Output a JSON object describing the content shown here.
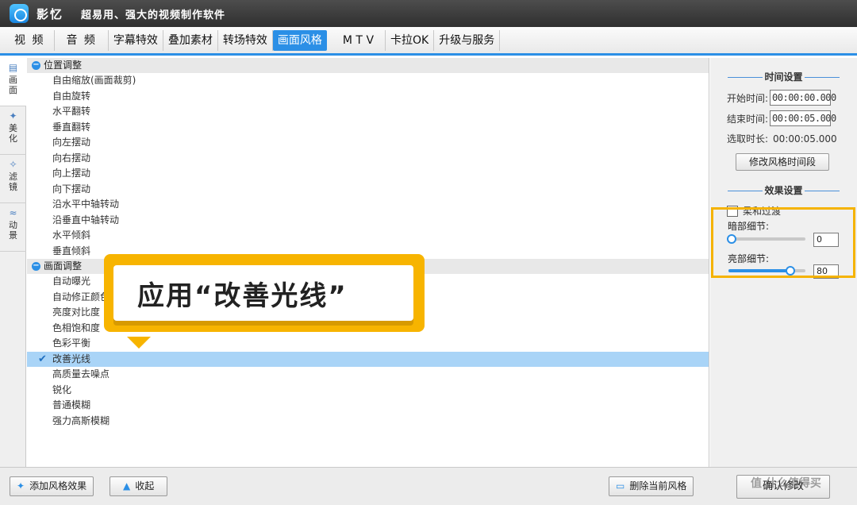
{
  "app": {
    "name": "影忆",
    "slogan": "超易用、强大的视频制作软件"
  },
  "menu": [
    {
      "label": "视 频"
    },
    {
      "label": "音 频"
    },
    {
      "label": "字幕特效"
    },
    {
      "label": "叠加素材"
    },
    {
      "label": "转场特效"
    },
    {
      "label": "画面风格",
      "active": true
    },
    {
      "label": "M T V"
    },
    {
      "label": "卡拉OK"
    },
    {
      "label": "升级与服务"
    }
  ],
  "left_tabs": [
    {
      "icon": "screen-icon",
      "label": "画面",
      "active": true
    },
    {
      "icon": "magic-wand-icon",
      "label": "美化"
    },
    {
      "icon": "filter-wand-icon",
      "label": "滤镜"
    },
    {
      "icon": "wave-icon",
      "label": "动景"
    }
  ],
  "groups": [
    {
      "title": "位置调整",
      "items": [
        "自由缩放(画面裁剪)",
        "自由旋转",
        "水平翻转",
        "垂直翻转",
        "向左摆动",
        "向右摆动",
        "向上摆动",
        "向下摆动",
        "沿水平中轴转动",
        "沿垂直中轴转动",
        "水平倾斜",
        "垂直倾斜"
      ]
    },
    {
      "title": "画面调整",
      "items": [
        "自动曝光",
        "自动修正颜色",
        "亮度对比度",
        "色相饱和度",
        "色彩平衡",
        "改善光线",
        "高质量去噪点",
        "锐化",
        "普通模糊",
        "强力高斯模糊"
      ]
    }
  ],
  "selected_item": "改善光线",
  "right": {
    "time_title": "时间设置",
    "start_label": "开始时间:",
    "start_value": "00:00:00.000",
    "end_label": "结束时间:",
    "end_value": "00:00:05.000",
    "duration_label": "选取时长:",
    "duration_value": "00:00:05.000",
    "modify_time_button": "修改风格时间段",
    "effect_title": "效果设置",
    "soft_transition_label": "柔和过渡",
    "dark_label": "暗部细节:",
    "dark_value": "0",
    "dark_fraction": 0.0,
    "bright_label": "亮部细节:",
    "bright_value": "80",
    "bright_fraction": 0.8,
    "confirm_button": "确认修改"
  },
  "bottom": {
    "add_button": "添加风格效果",
    "collapse_button": "收起",
    "delete_button": "删除当前风格"
  },
  "callout": {
    "text": "应用“改善光线”"
  },
  "watermark": "值 什么值得买",
  "colors": {
    "accent": "#2b8fe6",
    "highlight": "#f5b301",
    "selected_row": "#a9d4f7"
  }
}
